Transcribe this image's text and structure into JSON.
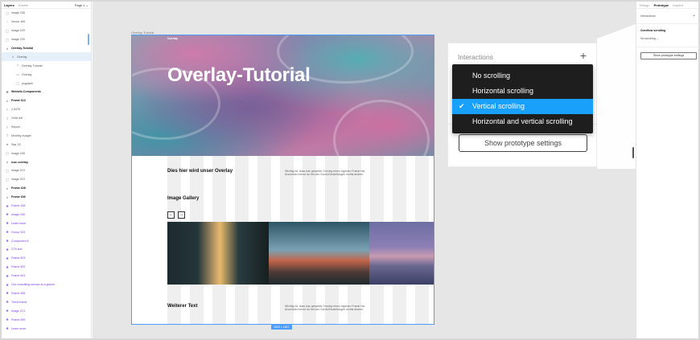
{
  "layers_panel": {
    "tabs": [
      "Layers",
      "Assets"
    ],
    "page": "Page 1 ⌄",
    "items": [
      {
        "label": "image 238",
        "icon": "image-icon",
        "kind": "normal"
      },
      {
        "label": "Vector 169",
        "icon": "vector-icon",
        "kind": "normal"
      },
      {
        "label": "image 229",
        "icon": "image-icon",
        "kind": "normal"
      },
      {
        "label": "image 229",
        "icon": "image-icon",
        "kind": "normal"
      },
      {
        "label": "Overlay-Tutorial",
        "icon": "frame-icon",
        "kind": "bold"
      },
      {
        "label": "Overlay",
        "icon": "frame-icon",
        "kind": "selected"
      },
      {
        "label": "Overlay-Tutorial",
        "icon": "text-icon",
        "kind": "indent2"
      },
      {
        "label": "Overlay",
        "icon": "rect-icon",
        "kind": "indent2"
      },
      {
        "label": "pngdash",
        "icon": "image-icon",
        "kind": "indent2"
      },
      {
        "label": "Website-Components",
        "icon": "component-icon",
        "kind": "bold"
      },
      {
        "label": "Frame 613",
        "icon": "frame-icon",
        "kind": "bold"
      },
      {
        "label": "2.547€",
        "icon": "text-icon",
        "kind": "normal"
      },
      {
        "label": "2436 left",
        "icon": "text-icon",
        "kind": "normal"
      },
      {
        "label": "Report",
        "icon": "text-icon",
        "kind": "normal"
      },
      {
        "label": "Monthly budget",
        "icon": "text-icon",
        "kind": "normal"
      },
      {
        "label": "Star 33",
        "icon": "star-icon",
        "kind": "normal"
      },
      {
        "label": "image 228",
        "icon": "image-icon",
        "kind": "normal"
      },
      {
        "label": "icon overlay",
        "icon": "frame-icon",
        "kind": "bold"
      },
      {
        "label": "image 219",
        "icon": "image-icon",
        "kind": "normal"
      },
      {
        "label": "image 219",
        "icon": "image-icon",
        "kind": "normal"
      },
      {
        "label": "Frame 628",
        "icon": "frame-icon",
        "kind": "bold"
      },
      {
        "label": "Frame 606",
        "icon": "frame-icon",
        "kind": "bold"
      },
      {
        "label": "Frame 206",
        "icon": "component-icon",
        "kind": "purple"
      },
      {
        "label": "Image 290",
        "icon": "component-icon",
        "kind": "purple"
      },
      {
        "label": "Learn more",
        "icon": "component-icon",
        "kind": "purple"
      },
      {
        "label": "Group 323",
        "icon": "component-icon",
        "kind": "purple"
      },
      {
        "label": "Component 6",
        "icon": "component-icon",
        "kind": "purple"
      },
      {
        "label": "CTA text",
        "icon": "component-icon",
        "kind": "purple"
      },
      {
        "label": "Frame 603",
        "icon": "component-icon",
        "kind": "purple"
      },
      {
        "label": "Frame 602",
        "icon": "component-icon",
        "kind": "purple"
      },
      {
        "label": "Frame 601",
        "icon": "component-icon",
        "kind": "purple"
      },
      {
        "label": "Our consulting service at a glance",
        "icon": "component-icon",
        "kind": "purple"
      },
      {
        "label": "Frame 598",
        "icon": "component-icon",
        "kind": "purple"
      },
      {
        "label": "Trend frame",
        "icon": "component-icon",
        "kind": "purple"
      },
      {
        "label": "image 213",
        "icon": "component-icon",
        "kind": "purple"
      },
      {
        "label": "Frame 599",
        "icon": "component-icon",
        "kind": "purple"
      },
      {
        "label": "Learn more",
        "icon": "component-icon",
        "kind": "purple"
      }
    ]
  },
  "canvas": {
    "frame_label": "Overlay-Tutorial",
    "hero_logo": "Overlay",
    "hero_title": "Overlay-Tutorial",
    "section1_heading": "Dies hier wird unser Overlay",
    "section1_text": "Wichtig ist, dass das gesamte Overlay einen eigenen Frame hat. Ansonsten kennt du bei den Scroll-Einstellungen nichts ändern.",
    "gallery_heading": "Image Gallery",
    "arrow_left": "←",
    "arrow_right": "→",
    "section2_heading": "Weiterer Text",
    "section2_text": "Wichtig ist, dass das gesamte Overlay einen eigenen Frame hat. Ansonsten kennt du bei den Scroll-Einstellungen nichts ändern.",
    "frame_size": "1920 × 1817"
  },
  "callout": {
    "title": "Interactions",
    "plus": "+",
    "button": "Show prototype settings",
    "options": [
      {
        "label": "No scrolling",
        "selected": false
      },
      {
        "label": "Horizontal scrolling",
        "selected": false
      },
      {
        "label": "Vertical scrolling",
        "selected": true
      },
      {
        "label": "Horizontal and vertical scrolling",
        "selected": false
      }
    ],
    "check": "✔"
  },
  "props_panel": {
    "tabs": [
      "Design",
      "Prototype",
      "Inspect"
    ],
    "interactions_label": "Interactions",
    "plus": "+",
    "overflow_label": "Overflow scrolling",
    "overflow_value": "No scrolling ⌄",
    "button": "Show prototype settings"
  },
  "colors": {
    "accent": "#18a0fb",
    "component_purple": "#7b3fe4",
    "selection_blue": "#4a9eff",
    "dropdown_bg": "#1e1e1e"
  }
}
